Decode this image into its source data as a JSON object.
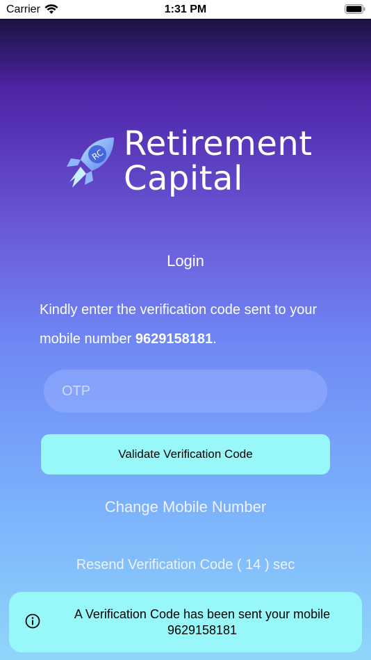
{
  "status_bar": {
    "carrier": "Carrier",
    "time": "1:31 PM"
  },
  "brand": {
    "line1": "Retirement",
    "line2": "Capital",
    "logo_badge": "RC"
  },
  "login": {
    "title": "Login",
    "instruction_prefix": "Kindly enter the verification code sent to your mobile number",
    "mobile_number": "9629158181",
    "instruction_suffix": ".",
    "otp_placeholder": "OTP",
    "otp_value": "",
    "validate_label": "Validate Verification Code",
    "change_mobile_label": "Change Mobile Number",
    "resend_label": "Resend Verification Code ( 14 ) sec"
  },
  "toast": {
    "icon": "info-icon",
    "message": "A Verification Code has been sent your mobile 9629158181"
  },
  "colors": {
    "accent_button": "#98f7f8",
    "gradient_top": "#1a1340",
    "gradient_mid": "#6f8bf6",
    "gradient_bottom": "#8fd6fb"
  }
}
